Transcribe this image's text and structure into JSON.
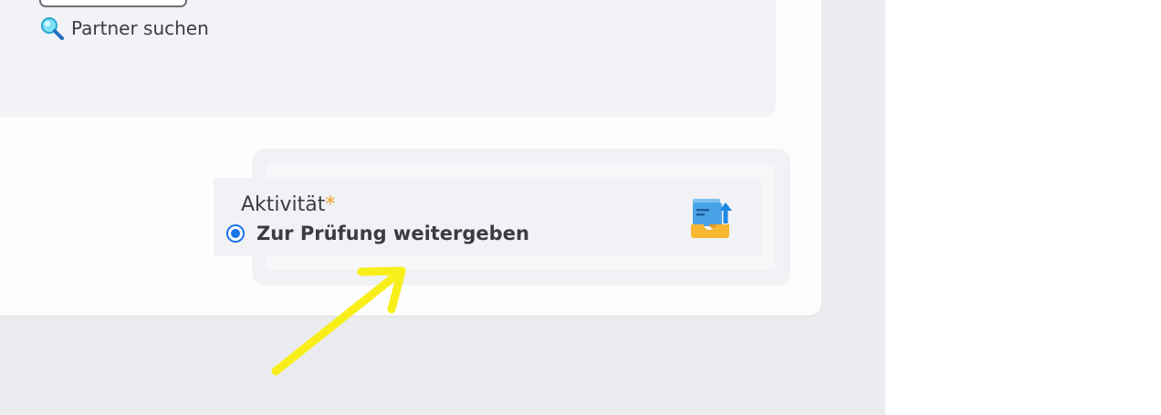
{
  "partner": {
    "search_label": "Partner suchen",
    "search_icon": "magnifier-icon"
  },
  "activity": {
    "label": "Aktivität",
    "required_marker": "*",
    "selected_option": "Zur Prüfung weitergeben",
    "icon": "inbox-upload-icon"
  },
  "colors": {
    "accent": "#1a73e8",
    "required": "#ef9b1e",
    "annotation_arrow": "#f8ef1a"
  }
}
